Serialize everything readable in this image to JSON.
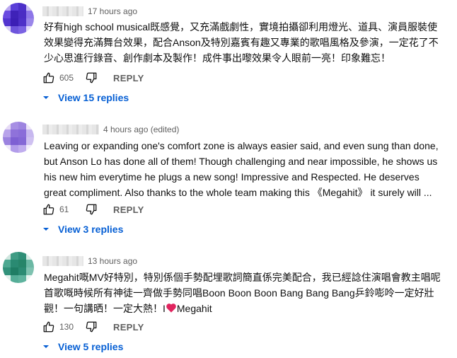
{
  "comments": [
    {
      "avatar_colors": [
        "#b9a6f0",
        "#5a3fd8",
        "#4b2fc9",
        "#c9bdf3",
        "#6a4be0",
        "#3f22b8",
        "#4a2cc4",
        "#8d76e8",
        "#5234cf",
        "#3c1fb5",
        "#4d30c8",
        "#9a86ea",
        "#d8cff7",
        "#6e55dc",
        "#7b63e3",
        "#e4dcfa"
      ],
      "time": "17 hours ago",
      "lines": [
        "好有high school musical既感覺，又充滿戲劇性，實境拍攝卻利用燈光、道具、演員服裝使",
        "效果變得充滿舞台效果，配合Anson及特別嘉賓有趣又專業的歌唱風格及參演，一定花了不",
        "少心思進行錄音、創作劇本及製作！成件事出嚟效果令人眼前一亮！印象難忘！"
      ],
      "likes": "605",
      "reply_label": "REPLY",
      "replies_label": "View 15 replies"
    },
    {
      "avatar_colors": [
        "#e6dbf6",
        "#a78fe4",
        "#9d84e0",
        "#ece4f8",
        "#b8a3ea",
        "#8f72da",
        "#8a6dd9",
        "#c7b8ef",
        "#9b82df",
        "#7e60d3",
        "#8468d6",
        "#cfc1f1",
        "#efe9fa",
        "#b29cea",
        "#c0adee",
        "#f3eefb"
      ],
      "time": "4 hours ago (edited)",
      "lines": [
        "Leaving or expanding one's comfort zone is always easier said, and even sung than done,",
        "but Anson Lo has done all of them!  Though challenging and near impossible, he shows us",
        "his new him everytime he plugs a new song!  Impressive and Respected.  He deserves",
        "great compliment.  Also thanks to the whole team making this 《Megahit》 it surely will ..."
      ],
      "likes": "61",
      "reply_label": "REPLY",
      "replies_label": "View 3 replies"
    },
    {
      "avatar_colors": [
        "#cfe6df",
        "#3f9c84",
        "#2f8f77",
        "#d7ece6",
        "#4da891",
        "#2a8a72",
        "#268569",
        "#6bb8a4",
        "#31917a",
        "#1f7d64",
        "#2b8b73",
        "#7ec2b0",
        "#e2f1ec",
        "#55ad97",
        "#5fb39e",
        "#e8f4f0"
      ],
      "time": "13 hours ago",
      "lines": [
        "Megahit嘅MV好特別，特別係個手勢配埋歌詞簡直係完美配合，我已經諗住演唱會教主唱呢",
        "首歌嘅時候所有神徒一齊做手勢同唱Boon Boon Boon Bang Bang Bang乒鈴嘭呤一定好壯"
      ],
      "last_line_prefix": "觀！一句講晒！一定大熱！I",
      "last_line_suffix": "Megahit",
      "likes": "130",
      "reply_label": "REPLY",
      "replies_label": "View 5 replies"
    }
  ],
  "icons": {
    "like": "thumbs-up-icon",
    "dislike": "thumbs-down-icon",
    "expand": "caret-down-icon",
    "heart": "red-heart-emoji"
  },
  "colors": {
    "link": "#065fd4",
    "secondary_text": "#606060",
    "heart": "#e0245e"
  }
}
